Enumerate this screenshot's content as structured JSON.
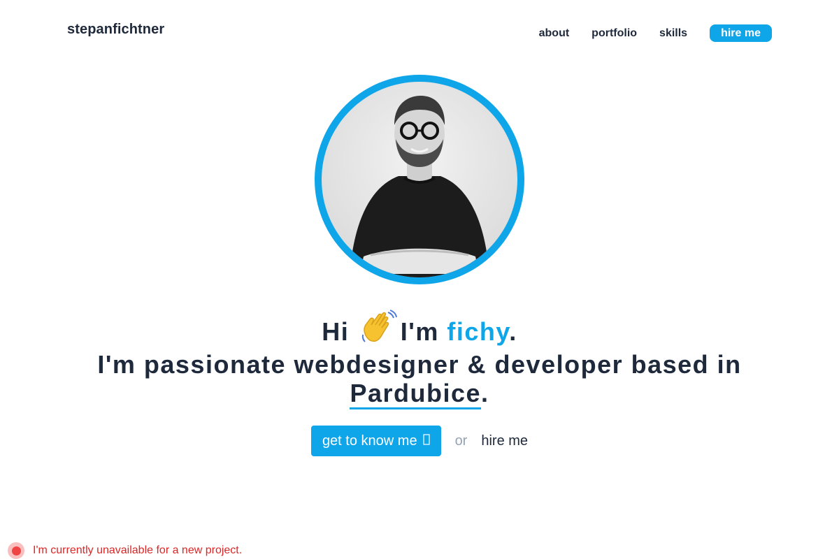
{
  "header": {
    "logo": "stepanfichtner",
    "nav": [
      {
        "label": "about"
      },
      {
        "label": "portfolio"
      },
      {
        "label": "skills"
      },
      {
        "label": "hire me"
      }
    ]
  },
  "hero": {
    "avatar_icon": "person-portrait-photo",
    "greeting_hi": "Hi",
    "wave_icon": "waving-hand-emoji",
    "greeting_im": "I'm",
    "name": "fichy",
    "period": ".",
    "tagline": "I'm passionate webdesigner & developer based in",
    "city": "Pardubice",
    "city_period": "."
  },
  "cta": {
    "primary_label": "get to know me",
    "primary_icon": "arrow-down-icon",
    "or_text": "or",
    "secondary_label": "hire me"
  },
  "status": {
    "text": "I'm currently unavailable for a new project.",
    "color": "#dc2626"
  },
  "colors": {
    "accent": "#0ea5e9",
    "text": "#1e293b",
    "muted": "#94a3b8",
    "status_red": "#ef4444"
  }
}
